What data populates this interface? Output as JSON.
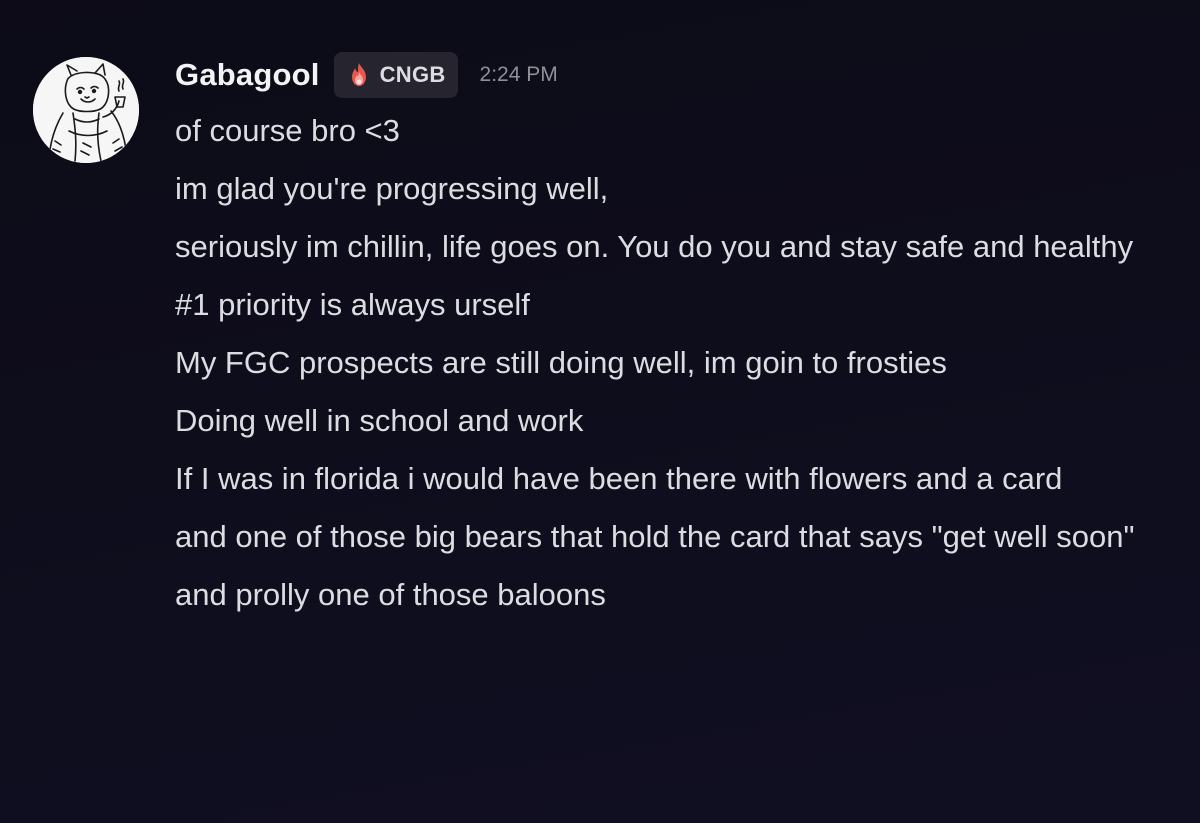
{
  "message": {
    "username": "Gabagool",
    "tag": {
      "icon": "flame-badge-icon",
      "label": "CNGB"
    },
    "timestamp": "2:24 PM",
    "avatar_icon": "avatar-drawing-icon",
    "lines": [
      "of course bro <3",
      "im glad you're progressing well,",
      "seriously im chillin, life goes on. You do you and stay safe and healthy",
      "#1 priority is always urself",
      "My FGC prospects are still doing well, im goin to frosties",
      "Doing well in school and work",
      "If I was in florida i would have been there with flowers and a card",
      "and one of those big bears that hold the card that says \"get well soon\"",
      "and prolly one of those baloons"
    ]
  },
  "colors": {
    "background": "#0d0c1a",
    "username": "#f2f3f5",
    "text": "#dbdee1",
    "timestamp": "#8e9098",
    "tag_background": "#25242f",
    "tag_flame": "#e8574f"
  }
}
